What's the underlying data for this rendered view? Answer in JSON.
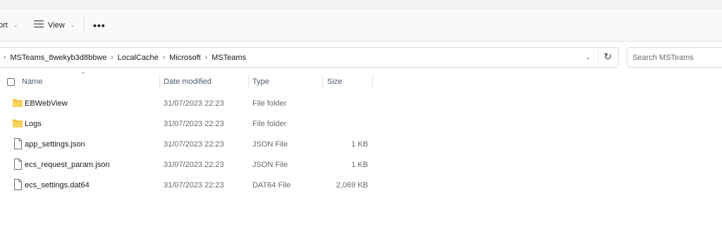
{
  "toolbar": {
    "sort_label": "ort",
    "view_label": "View",
    "more_label": "•••"
  },
  "address": {
    "crumbs": [
      "MSTeams_8wekyb3d8bbwe",
      "LocalCache",
      "Microsoft",
      "MSTeams"
    ]
  },
  "search": {
    "placeholder": "Search MSTeams"
  },
  "columns": {
    "name": "Name",
    "date": "Date modified",
    "type": "Type",
    "size": "Size"
  },
  "files": [
    {
      "name": "EBWebView",
      "date": "31/07/2023 22:23",
      "type": "File folder",
      "size": "",
      "icon": "folder-icon"
    },
    {
      "name": "Logs",
      "date": "31/07/2023 22:23",
      "type": "File folder",
      "size": "",
      "icon": "folder-icon"
    },
    {
      "name": "app_settings.json",
      "date": "31/07/2023 22:23",
      "type": "JSON File",
      "size": "1 KB",
      "icon": "file-icon"
    },
    {
      "name": "ecs_request_param.json",
      "date": "31/07/2023 22:23",
      "type": "JSON File",
      "size": "1 KB",
      "icon": "file-icon"
    },
    {
      "name": "ecs_settings.dat64",
      "date": "31/07/2023 22:23",
      "type": "DAT64 File",
      "size": "2,069 KB",
      "icon": "file-icon"
    }
  ],
  "colors": {
    "folder": "#f3c54a",
    "header_text": "#4d5a70",
    "secondary_text": "#6a6a6a"
  }
}
